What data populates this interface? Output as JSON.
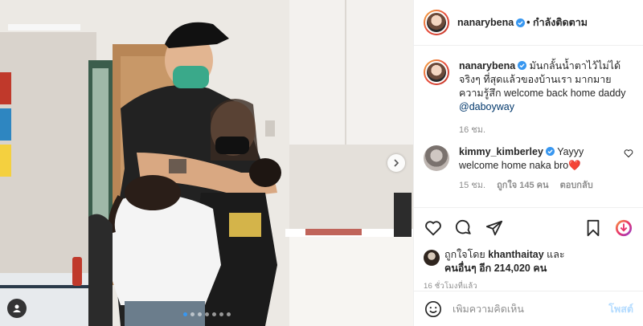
{
  "post": {
    "author": "nanarybena",
    "follow_state": "• กำลังติดตาม",
    "caption_line1": "มันกลั้นน้ำตาไว้ไม่ได้จริงๆ ที่สุดแล้วของบ้านเรา มากมายความรู้สึก welcome back home daddy",
    "caption_mention": "@daboyway",
    "caption_time": "16 ชม.",
    "image_dot_count": 7,
    "active_dot_index": 0
  },
  "comments": [
    {
      "username": "kimmy_kimberley",
      "text": "Yayyy welcome home naka bro",
      "emoji": "❤️",
      "time": "15 ชม.",
      "likes": "ถูกใจ 145 คน",
      "reply": "ตอบกลับ"
    }
  ],
  "likes_block": {
    "prefix": "ถูกใจโดย",
    "user": "khanthaitay",
    "conj": "และ",
    "others_label": "คนอื่นๆ อีก 214,020 คน"
  },
  "time_ago": "16 ชั่วโมงที่แล้ว",
  "add_comment": {
    "placeholder": "เพิ่มความคิดเห็น",
    "post_label": "โพสต์"
  },
  "colors": {
    "verified": "#3897f0",
    "heart": "#ed4956",
    "post_disabled": "#b3dbff",
    "mention": "#00376b"
  }
}
